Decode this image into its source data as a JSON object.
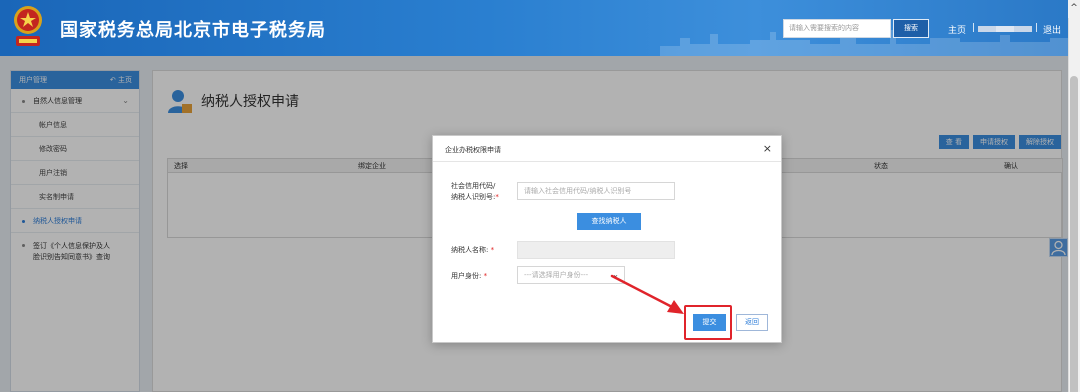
{
  "header": {
    "site_title": "国家税务总局北京市电子税务局",
    "search_placeholder": "请输入需要搜索的内容",
    "search_button": "搜索",
    "nav_home": "主页",
    "separator": "|",
    "nav_logout": "退出",
    "corner_glyph": "^"
  },
  "sidebar": {
    "header_label": "用户管理",
    "header_home": "主页",
    "items": [
      {
        "label": "自然人信息管理",
        "level": 1,
        "expanded": true
      },
      {
        "label": "帐户信息",
        "level": 2
      },
      {
        "label": "修改密码",
        "level": 2
      },
      {
        "label": "用户注销",
        "level": 2
      },
      {
        "label": "实名制申请",
        "level": 2
      },
      {
        "label": "纳税人授权申请",
        "level": 1,
        "active": true
      },
      {
        "label_line1": "签订《个人信息保护及人",
        "label_line2": "脸识别告知同意书》查询",
        "level": 1
      }
    ]
  },
  "main": {
    "page_title": "纳税人授权申请",
    "actions": [
      "查 看",
      "申请授权",
      "解除授权"
    ],
    "grid_headers": [
      "选择",
      "绑定企业",
      "状态",
      "确认"
    ]
  },
  "modal": {
    "title": "企业办税权限申请",
    "close": "×",
    "credit_code_label_line1": "社会信用代码/",
    "credit_code_label_line2": "纳税人识别号:",
    "credit_code_placeholder": "请输入社会信用代码/纳税人识别号",
    "find_button": "查找纳税人",
    "taxpayer_name_label": "纳税人名称:",
    "identity_label": "用户身份:",
    "identity_placeholder": "---请选择用户身份---",
    "required_mark": "*",
    "submit_button": "提交",
    "back_button": "返回"
  },
  "colors": {
    "accent": "#3b8ee0",
    "header": "#2a7fd0",
    "highlight": "#e0242b",
    "active_text": "#2f7ed8"
  },
  "icons": [
    "national-emblem-icon",
    "home-icon",
    "chevron-down-icon",
    "user-page-icon",
    "close-icon",
    "user-float-icon",
    "annotation-arrow-icon"
  ]
}
